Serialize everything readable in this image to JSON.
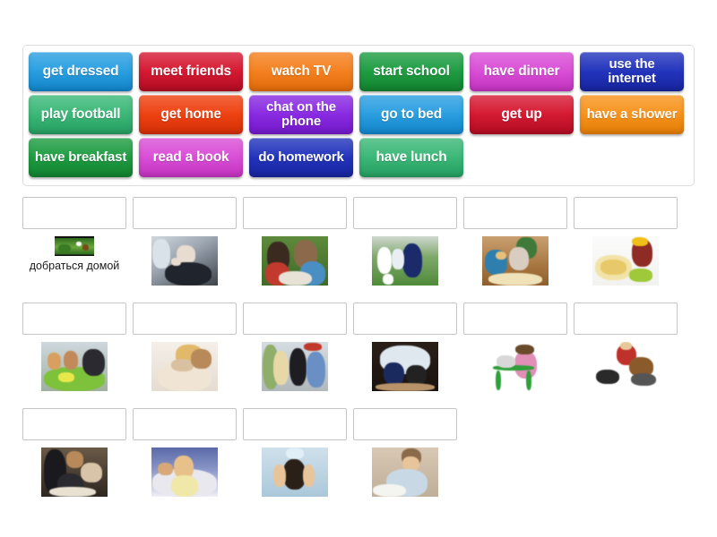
{
  "activity": {
    "type": "match-up",
    "language_note": "English daily routines matching activity"
  },
  "tile_bank": {
    "rows": [
      [
        {
          "label": "get dressed",
          "color": "#2b9fe0",
          "color_dark": "#1183c8",
          "lines": 1
        },
        {
          "label": "meet friends",
          "color": "#d61a33",
          "color_dark": "#b00c22",
          "lines": 1
        },
        {
          "label": "watch TV",
          "color": "#f48120",
          "color_dark": "#e06a08",
          "lines": 1
        },
        {
          "label": "start school",
          "color": "#1f9d43",
          "color_dark": "#13812f",
          "lines": 1
        },
        {
          "label": "have dinner",
          "color": "#d94fd6",
          "color_dark": "#c132bd",
          "lines": 1
        },
        {
          "label": "use the internet",
          "color": "#2435bd",
          "color_dark": "#16249c",
          "lines": 2
        }
      ],
      [
        {
          "label": "play football",
          "color": "#3cb878",
          "color_dark": "#259d60",
          "lines": 1
        },
        {
          "label": "get home",
          "color": "#ef4212",
          "color_dark": "#d22f06",
          "lines": 1
        },
        {
          "label": "chat on the phone",
          "color": "#8a2be2",
          "color_dark": "#7118c7",
          "lines": 2
        },
        {
          "label": "go to bed",
          "color": "#2b9fe0",
          "color_dark": "#1183c8",
          "lines": 1
        },
        {
          "label": "get up",
          "color": "#d61a33",
          "color_dark": "#b00c22",
          "lines": 1
        },
        {
          "label": "have a shower",
          "color": "#f7941e",
          "color_dark": "#e27c06",
          "lines": 2
        }
      ],
      [
        {
          "label": "have breakfast",
          "color": "#1f9d43",
          "color_dark": "#13812f",
          "lines": 2
        },
        {
          "label": "read a book",
          "color": "#d94fd6",
          "color_dark": "#c132bd",
          "lines": 1
        },
        {
          "label": "do homework",
          "color": "#2435bd",
          "color_dark": "#16249c",
          "lines": 2
        },
        {
          "label": "have lunch",
          "color": "#3cb878",
          "color_dark": "#259d60",
          "lines": 1
        }
      ]
    ]
  },
  "match_rows": [
    {
      "cells": [
        {
          "dropzone_value": "",
          "image": "get-home-thumbnail",
          "caption": "добраться домой",
          "tiny": true
        },
        {
          "dropzone_value": "",
          "image": "boy-on-phone-photo",
          "caption": "",
          "tiny": false
        },
        {
          "dropzone_value": "",
          "image": "children-reading-book-photo",
          "caption": "",
          "tiny": false
        },
        {
          "dropzone_value": "",
          "image": "boys-playing-football-photo",
          "caption": "",
          "tiny": false
        },
        {
          "dropzone_value": "",
          "image": "family-eating-dinner-photo",
          "caption": "",
          "tiny": false
        },
        {
          "dropzone_value": "",
          "image": "cereal-bowl-breakfast-photo",
          "caption": "",
          "tiny": false
        }
      ]
    },
    {
      "cells": [
        {
          "dropzone_value": "",
          "image": "children-school-lunch-photo",
          "caption": "",
          "tiny": false
        },
        {
          "dropzone_value": "",
          "image": "girl-sleeping-in-bed-photo",
          "caption": "",
          "tiny": false
        },
        {
          "dropzone_value": "",
          "image": "teenagers-meeting-friends-photo",
          "caption": "",
          "tiny": false
        },
        {
          "dropzone_value": "",
          "image": "children-watching-tv-photo",
          "caption": "",
          "tiny": false
        },
        {
          "dropzone_value": "",
          "image": "girl-at-computer-clipart",
          "caption": "",
          "tiny": false
        },
        {
          "dropzone_value": "",
          "image": "toddler-putting-on-shoes-photo",
          "caption": "",
          "tiny": false
        }
      ]
    },
    {
      "cells": [
        {
          "dropzone_value": "",
          "image": "classroom-school-start-photo",
          "caption": "",
          "tiny": false
        },
        {
          "dropzone_value": "",
          "image": "woman-waking-up-stretching-photo",
          "caption": "",
          "tiny": false
        },
        {
          "dropzone_value": "",
          "image": "woman-taking-shower-photo",
          "caption": "",
          "tiny": false
        },
        {
          "dropzone_value": "",
          "image": "boy-doing-homework-photo",
          "caption": "",
          "tiny": false
        }
      ]
    }
  ],
  "colors": {
    "page_background": "#ffffff",
    "bank_border": "#dcdcdc",
    "dropzone_border": "#c5c5c5",
    "tile_text": "#ffffff"
  }
}
